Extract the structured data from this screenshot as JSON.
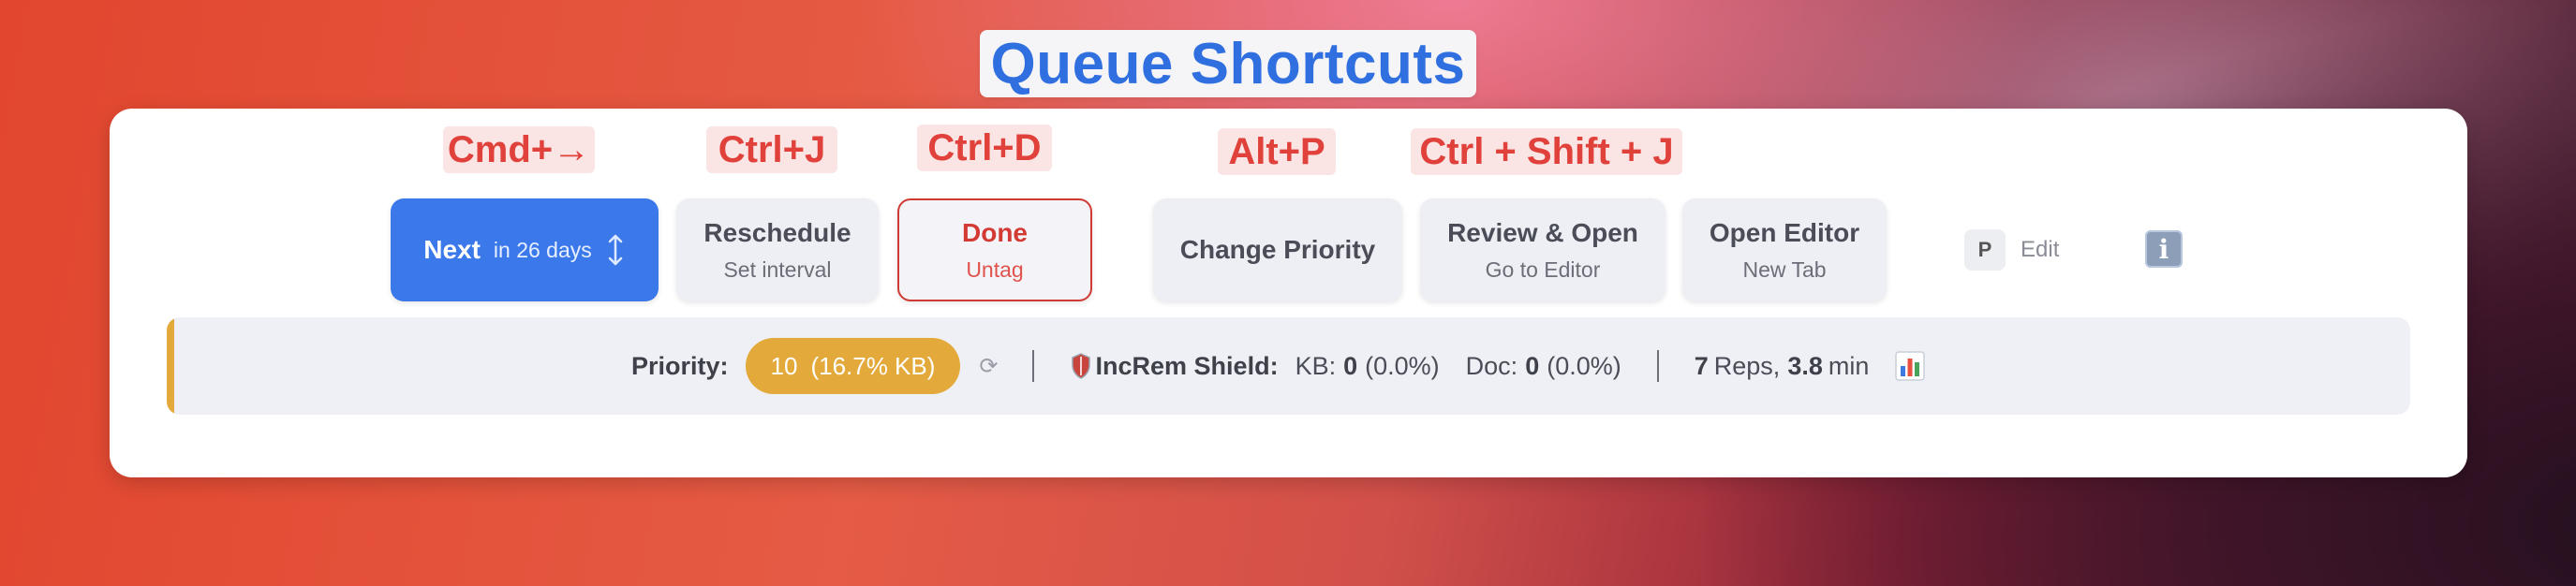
{
  "title": "Queue Shortcuts",
  "shortcuts": {
    "next": "Cmd+→",
    "reschedule": "Ctrl+J",
    "done": "Ctrl+D",
    "priority": "Alt+P",
    "review_open": "Ctrl + Shift + J"
  },
  "buttons": {
    "next": {
      "label": "Next",
      "sub": "in 26 days"
    },
    "reschedule": {
      "label": "Reschedule",
      "sub": "Set interval"
    },
    "done": {
      "label": "Done",
      "sub": "Untag"
    },
    "change_priority": {
      "label": "Change Priority"
    },
    "review_open": {
      "label": "Review & Open",
      "sub": "Go to Editor"
    },
    "open_editor": {
      "label": "Open Editor",
      "sub": "New Tab"
    }
  },
  "edit": {
    "key": "P",
    "label": "Edit"
  },
  "info_icon": "i",
  "priority_bar": {
    "priority_label": "Priority:",
    "priority_value": "10",
    "priority_detail": "(16.7% KB)",
    "refresh_icon": "⟳",
    "shield_label": "IncRem Shield:",
    "kb_label": "KB:",
    "kb_value": "0",
    "kb_pct": "(0.0%)",
    "doc_label": "Doc:",
    "doc_value": "0",
    "doc_pct": "(0.0%)",
    "reps_value": "7",
    "reps_label": "Reps,",
    "min_value": "3.8",
    "min_label": "min"
  },
  "colors": {
    "accent_blue": "#3b79ea",
    "shortcut_red": "#e0413b",
    "priority_gold": "#e3a93a"
  },
  "icons": {
    "arrows": "up-down-arrows-icon",
    "shield": "shield-icon",
    "stats": "bar-chart-icon",
    "info": "info-icon"
  }
}
